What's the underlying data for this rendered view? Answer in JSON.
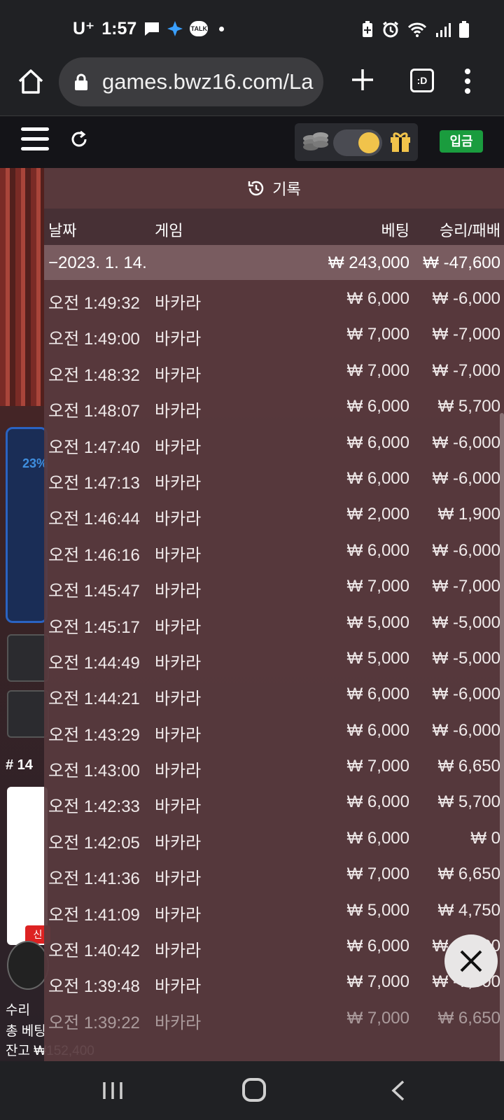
{
  "status_bar": {
    "carrier": "U⁺",
    "time": "1:57",
    "icons": [
      "message-icon",
      "ai-sparkle-icon",
      "kakaotalk-icon",
      "dot-icon",
      "battery-saver-icon",
      "alarm-icon",
      "wifi-icon",
      "signal-icon",
      "battery-icon"
    ],
    "talk_label": "TALK"
  },
  "browser": {
    "url": "games.bwz16.com/La",
    "tabs_label": ":D"
  },
  "game_header": {
    "deposit_label": "입금",
    "toggle_on": true
  },
  "background": {
    "progress_pct": "23%",
    "round_number": "# 14",
    "new_tag": "신",
    "footer_line1": "수리",
    "footer_line2": "총 베팅",
    "footer_line3": "잔고 ₩152,400"
  },
  "history": {
    "title": "기록",
    "columns": {
      "date": "날짜",
      "game": "게임",
      "bet": "베팅",
      "result": "승리/패배"
    },
    "date_group": {
      "date": "−2023. 1. 14.",
      "bet_total": "₩ 243,000",
      "result_total": "₩ -47,600"
    },
    "rows": [
      {
        "time": "오전 1:49:32",
        "game": "바카라",
        "bet": "₩ 6,000",
        "result": "₩ -6,000"
      },
      {
        "time": "오전 1:49:00",
        "game": "바카라",
        "bet": "₩ 7,000",
        "result": "₩ -7,000"
      },
      {
        "time": "오전 1:48:32",
        "game": "바카라",
        "bet": "₩ 7,000",
        "result": "₩ -7,000"
      },
      {
        "time": "오전 1:48:07",
        "game": "바카라",
        "bet": "₩ 6,000",
        "result": "₩ 5,700"
      },
      {
        "time": "오전 1:47:40",
        "game": "바카라",
        "bet": "₩ 6,000",
        "result": "₩ -6,000"
      },
      {
        "time": "오전 1:47:13",
        "game": "바카라",
        "bet": "₩ 6,000",
        "result": "₩ -6,000"
      },
      {
        "time": "오전 1:46:44",
        "game": "바카라",
        "bet": "₩ 2,000",
        "result": "₩ 1,900"
      },
      {
        "time": "오전 1:46:16",
        "game": "바카라",
        "bet": "₩ 6,000",
        "result": "₩ -6,000"
      },
      {
        "time": "오전 1:45:47",
        "game": "바카라",
        "bet": "₩ 7,000",
        "result": "₩ -7,000"
      },
      {
        "time": "오전 1:45:17",
        "game": "바카라",
        "bet": "₩ 5,000",
        "result": "₩ -5,000"
      },
      {
        "time": "오전 1:44:49",
        "game": "바카라",
        "bet": "₩ 5,000",
        "result": "₩ -5,000"
      },
      {
        "time": "오전 1:44:21",
        "game": "바카라",
        "bet": "₩ 6,000",
        "result": "₩ -6,000"
      },
      {
        "time": "오전 1:43:29",
        "game": "바카라",
        "bet": "₩ 6,000",
        "result": "₩ -6,000"
      },
      {
        "time": "오전 1:43:00",
        "game": "바카라",
        "bet": "₩ 7,000",
        "result": "₩ 6,650"
      },
      {
        "time": "오전 1:42:33",
        "game": "바카라",
        "bet": "₩ 6,000",
        "result": "₩ 5,700"
      },
      {
        "time": "오전 1:42:05",
        "game": "바카라",
        "bet": "₩ 6,000",
        "result": "₩ 0"
      },
      {
        "time": "오전 1:41:36",
        "game": "바카라",
        "bet": "₩ 7,000",
        "result": "₩ 6,650"
      },
      {
        "time": "오전 1:41:09",
        "game": "바카라",
        "bet": "₩ 5,000",
        "result": "₩ 4,750"
      },
      {
        "time": "오전 1:40:42",
        "game": "바카라",
        "bet": "₩ 6,000",
        "result": "₩ -6,000"
      },
      {
        "time": "오전 1:39:48",
        "game": "바카라",
        "bet": "₩ 7,000",
        "result": "₩ -7,000"
      },
      {
        "time": "오전 1:39:22",
        "game": "바카라",
        "bet": "₩ 7,000",
        "result": "₩ 6,650"
      }
    ]
  },
  "colors": {
    "deposit_green": "#1a9c3e",
    "toggle_knob": "#f1c34b",
    "panel_bg": "#583a3e"
  }
}
